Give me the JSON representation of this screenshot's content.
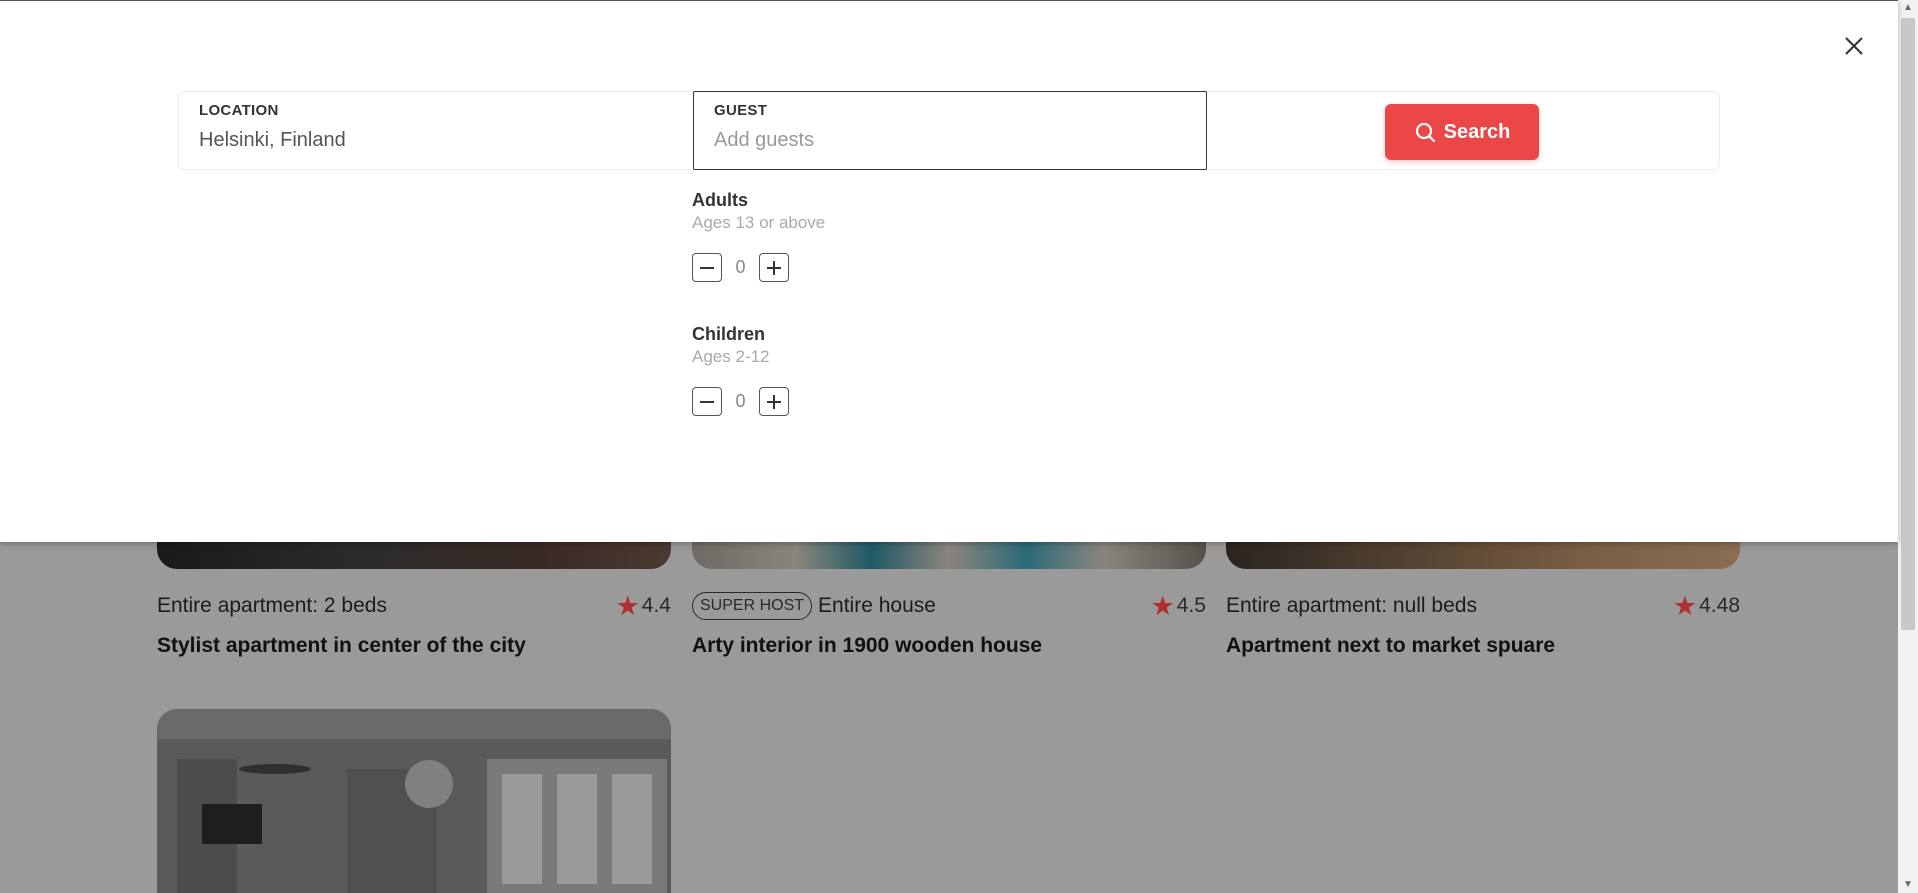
{
  "search": {
    "location_label": "LOCATION",
    "location_value": "Helsinki, Finland",
    "guest_label": "GUEST",
    "guest_placeholder": "Add guests",
    "search_label": "Search"
  },
  "guests": {
    "adults": {
      "title": "Adults",
      "subtitle": "Ages 13 or above",
      "count": "0"
    },
    "children": {
      "title": "Children",
      "subtitle": "Ages 2-12",
      "count": "0"
    }
  },
  "listings": [
    {
      "type": "Entire apartment: 2 beds",
      "rating": "4.4",
      "title": "Stylist apartment in center of the city",
      "superhost": ""
    },
    {
      "type": "Entire house",
      "rating": "4.5",
      "title": "Arty interior in 1900 wooden house",
      "superhost": "SUPER HOST"
    },
    {
      "type": "Entire apartment: null beds",
      "rating": "4.48",
      "title": "Apartment next to market spuare",
      "superhost": ""
    }
  ],
  "colors": {
    "accent": "#eb4747",
    "star": "#b03030"
  },
  "icons": {
    "close": "close-icon",
    "search": "search-icon",
    "star": "star-icon",
    "minus": "minus-icon",
    "plus": "plus-icon"
  }
}
